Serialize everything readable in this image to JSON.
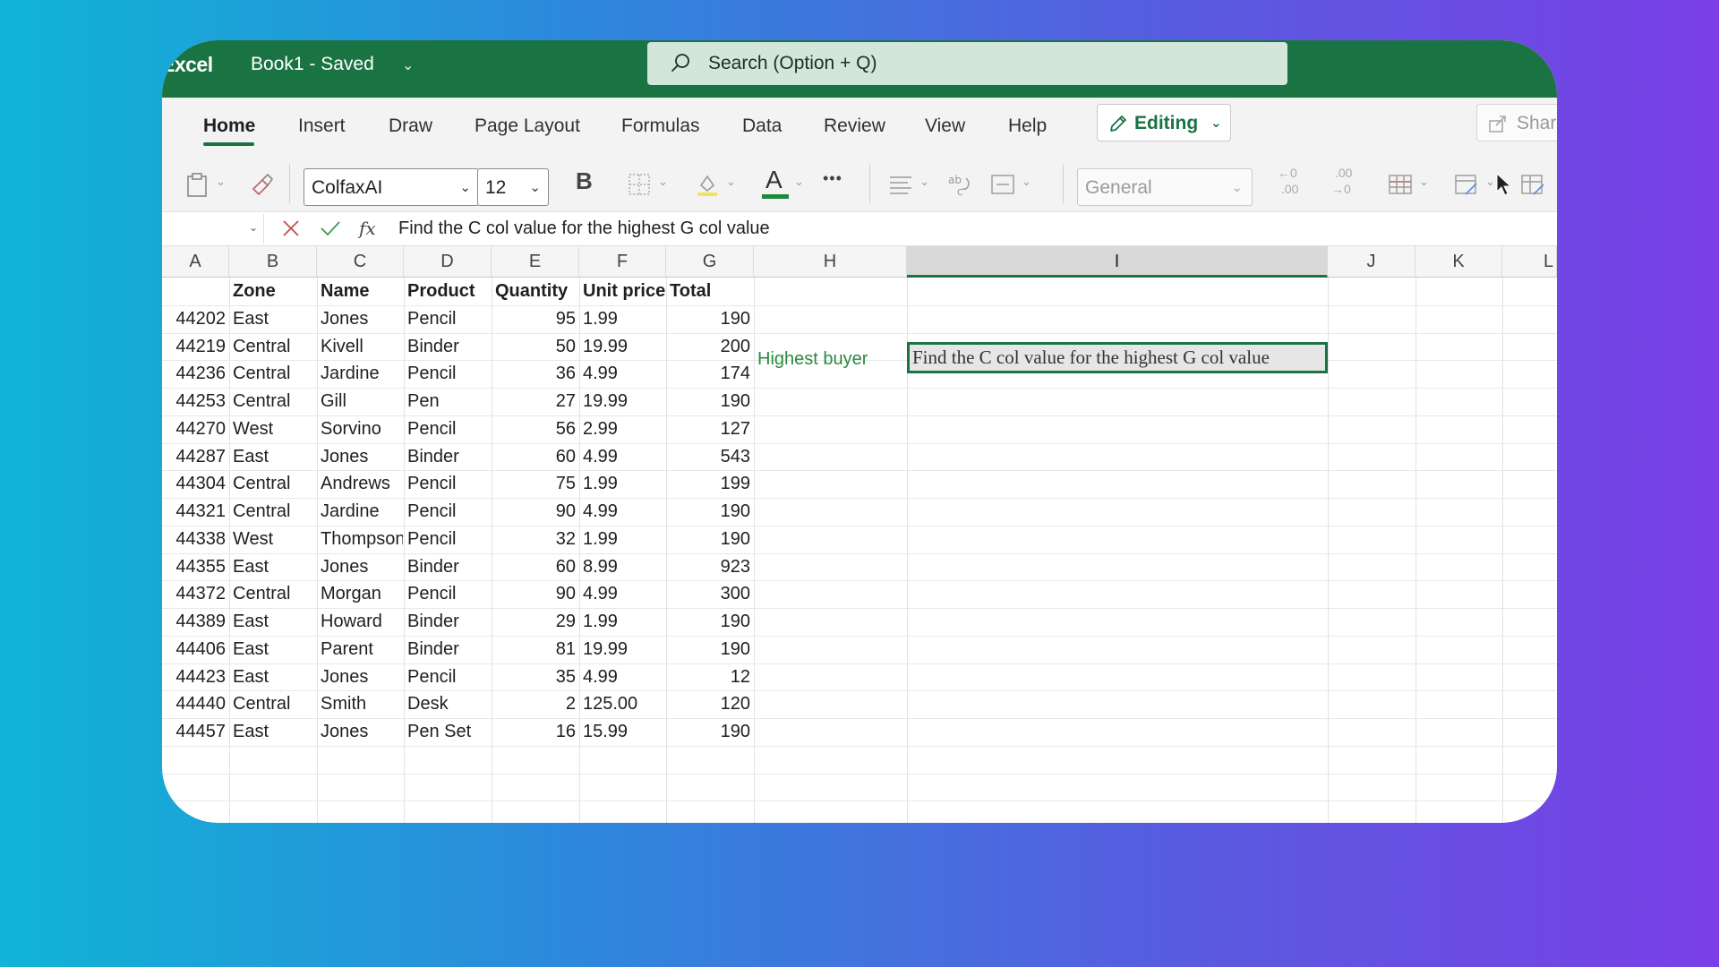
{
  "titlebar": {
    "app_name": "Excel",
    "doc_title": "Book1  -  Saved",
    "search_placeholder": "Search (Option + Q)"
  },
  "tabs": [
    {
      "label": "Home",
      "active": true
    },
    {
      "label": "Insert"
    },
    {
      "label": "Draw"
    },
    {
      "label": "Page Layout"
    },
    {
      "label": "Formulas"
    },
    {
      "label": "Data"
    },
    {
      "label": "Review"
    },
    {
      "label": "View"
    },
    {
      "label": "Help"
    }
  ],
  "editing_label": "Editing",
  "share_label": "Share",
  "ribbon": {
    "font_name": "ColfaxAI",
    "font_size": "12",
    "number_format": "General",
    "bold_label": "B",
    "font_color_label": "A",
    "more_label": "•••",
    "decimal_increase": ".00",
    "decimal_decrease": ".00"
  },
  "formula_bar": {
    "name_box": "",
    "fx_label": "fx",
    "formula": "Find the C col value for the highest G col value"
  },
  "columns": [
    "A",
    "B",
    "C",
    "D",
    "E",
    "F",
    "G",
    "H",
    "I",
    "J",
    "K",
    "L"
  ],
  "selected_column": "I",
  "header_row": [
    "",
    "Zone",
    "Name",
    "Product",
    "Quantity",
    "Unit price",
    "Total"
  ],
  "rows": [
    [
      "44202",
      "East",
      "Jones",
      "Pencil",
      "95",
      "1.99",
      "190"
    ],
    [
      "44219",
      "Central",
      "Kivell",
      "Binder",
      "50",
      "19.99",
      "200"
    ],
    [
      "44236",
      "Central",
      "Jardine",
      "Pencil",
      "36",
      "4.99",
      "174"
    ],
    [
      "44253",
      "Central",
      "Gill",
      "Pen",
      "27",
      "19.99",
      "190"
    ],
    [
      "44270",
      "West",
      "Sorvino",
      "Pencil",
      "56",
      "2.99",
      "127"
    ],
    [
      "44287",
      "East",
      "Jones",
      "Binder",
      "60",
      "4.99",
      "543"
    ],
    [
      "44304",
      "Central",
      "Andrews",
      "Pencil",
      "75",
      "1.99",
      "199"
    ],
    [
      "44321",
      "Central",
      "Jardine",
      "Pencil",
      "90",
      "4.99",
      "190"
    ],
    [
      "44338",
      "West",
      "Thompson",
      "Pencil",
      "32",
      "1.99",
      "190"
    ],
    [
      "44355",
      "East",
      "Jones",
      "Binder",
      "60",
      "8.99",
      "923"
    ],
    [
      "44372",
      "Central",
      "Morgan",
      "Pencil",
      "90",
      "4.99",
      "300"
    ],
    [
      "44389",
      "East",
      "Howard",
      "Binder",
      "29",
      "1.99",
      "190"
    ],
    [
      "44406",
      "East",
      "Parent",
      "Binder",
      "81",
      "19.99",
      "190"
    ],
    [
      "44423",
      "East",
      "Jones",
      "Pencil",
      "35",
      "4.99",
      "12"
    ],
    [
      "44440",
      "Central",
      "Smith",
      "Desk",
      "2",
      "125.00",
      "120"
    ],
    [
      "44457",
      "East",
      "Jones",
      "Pen Set",
      "16",
      "15.99",
      "190"
    ]
  ],
  "highest_buyer_label": "Highest buyer",
  "selected_cell_text": "Find the C col value for the highest G col value",
  "colors": {
    "brand_green": "#1a7343",
    "label_green": "#2b8a3e"
  }
}
